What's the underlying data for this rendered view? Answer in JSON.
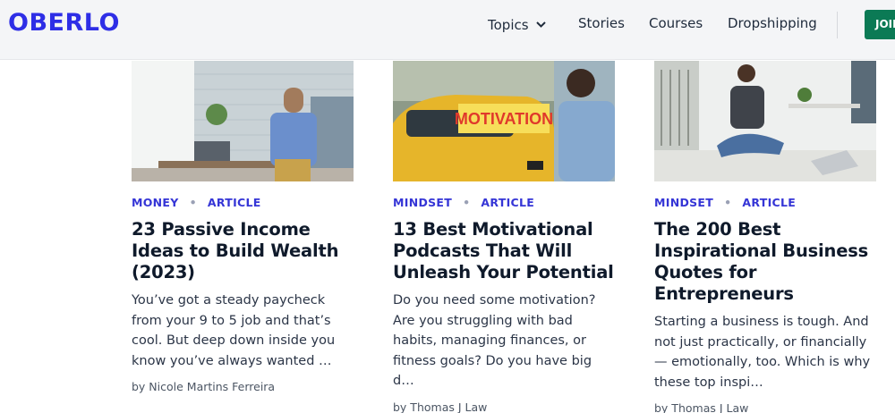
{
  "header": {
    "logo": "OBERLO",
    "nav": {
      "topics": "Topics",
      "stories": "Stories",
      "courses": "Courses",
      "dropshipping": "Dropshipping"
    },
    "join_label": "JOIN"
  },
  "cards": [
    {
      "category": "MONEY",
      "type": "ARTICLE",
      "title": "23 Passive Income Ideas to Build Wealth (2023)",
      "excerpt": "You’ve got a steady paycheck from your 9 to 5 job and that’s cool.  But deep down inside you know you’ve always wanted …",
      "author": "by Nicole Martins Ferreira"
    },
    {
      "category": "MINDSET",
      "type": "ARTICLE",
      "title": "13 Best Motivational Podcasts That Will Unleash Your Potential",
      "excerpt": "Do you need some motivation? Are you struggling with bad habits, managing finances, or fitness goals? Do you have big d…",
      "author": "by Thomas J Law",
      "image_text": "MOTIVATION"
    },
    {
      "category": "MINDSET",
      "type": "ARTICLE",
      "title": "The 200 Best Inspirational Business Quotes for Entrepreneurs",
      "excerpt": "Starting a business is tough. And not just practically, or financially — emotionally, too. Which is why these top inspi…",
      "author": "by Thomas J Law"
    }
  ],
  "colors": {
    "brand": "#2e2ee6",
    "category": "#3535d6",
    "cta": "#0b7a55"
  }
}
